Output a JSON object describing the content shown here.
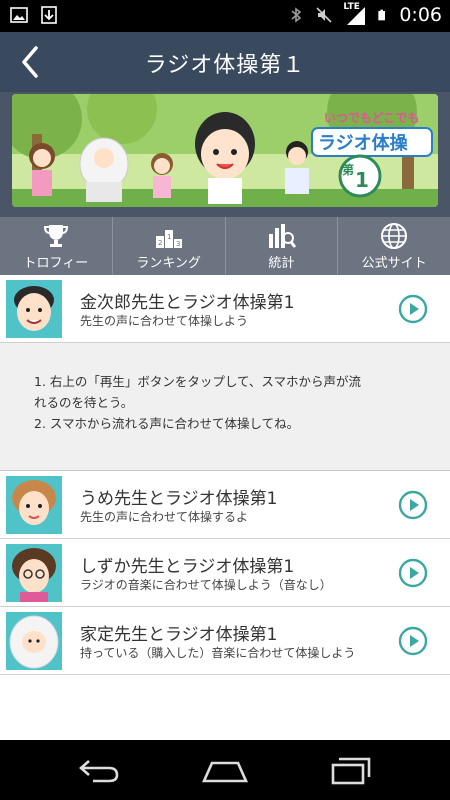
{
  "statusbar": {
    "time": "0:06",
    "network": "LTE"
  },
  "appbar": {
    "title": "ラジオ体操第１"
  },
  "banner": {
    "logo_line1": "いつでもどこでも",
    "logo_main": "ラジオ体操",
    "logo_badge_kanji": "第",
    "logo_badge_num": "1"
  },
  "toolbar": {
    "items": [
      {
        "label": "トロフィー",
        "icon": "trophy-icon"
      },
      {
        "label": "ランキング",
        "icon": "ranking-podium-icon"
      },
      {
        "label": "統計",
        "icon": "stats-search-icon"
      },
      {
        "label": "公式サイト",
        "icon": "globe-icon"
      }
    ]
  },
  "list": {
    "items": [
      {
        "title": "金次郎先生とラジオ体操第1",
        "subtitle": "先生の声に合わせて体操しよう"
      },
      {
        "title": "うめ先生とラジオ体操第1",
        "subtitle": "先生の声に合わせて体操するよ"
      },
      {
        "title": "しずか先生とラジオ体操第1",
        "subtitle": "ラジオの音楽に合わせて体操しよう（音なし）"
      },
      {
        "title": "家定先生とラジオ体操第1",
        "subtitle": "持っている（購入した）音楽に合わせて体操しよう"
      }
    ]
  },
  "instructions": {
    "line1": "1. 右上の「再生」ボタンをタップして、スマホから声が流",
    "line1b": "れるのを待とう。",
    "line2": "2. スマホから流れる声に合わせて体操してね。"
  },
  "colors": {
    "appbar": "#3a4a5e",
    "toolbar": "#6b7480",
    "play_accent": "#3aa8a0"
  }
}
